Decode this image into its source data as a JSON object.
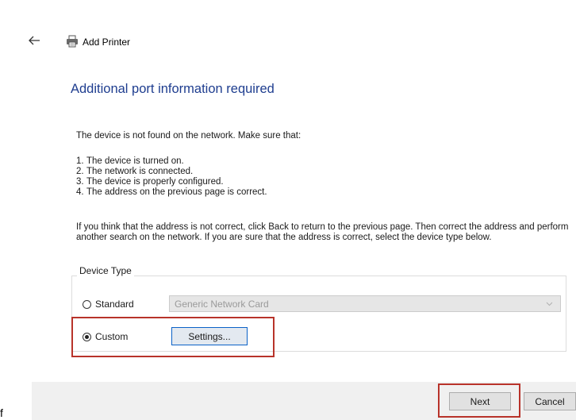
{
  "window": {
    "title": "Add Printer",
    "back_icon": "back-arrow-icon",
    "printer_icon": "printer-icon"
  },
  "heading": "Additional port information required",
  "intro": "The device is not found on the network. Make sure that:",
  "steps": [
    {
      "num": "1.",
      "text": "The device is turned on."
    },
    {
      "num": "2.",
      "text": "The network is connected."
    },
    {
      "num": "3.",
      "text": "The device is properly configured."
    },
    {
      "num": "4.",
      "text": "The address on the previous page is correct."
    }
  ],
  "paragraph": "If you think that the address is not correct, click Back to return to the previous page. Then correct the address and perform another search on the network. If you are sure that the address is correct, select the device type below.",
  "device_type": {
    "label": "Device Type",
    "standard_label": "Standard",
    "standard_selected": false,
    "standard_select_value": "Generic Network Card",
    "custom_label": "Custom",
    "custom_selected": true,
    "settings_label": "Settings..."
  },
  "footer": {
    "stray_text": "f",
    "next_label": "Next",
    "cancel_label": "Cancel"
  },
  "colors": {
    "heading": "#1e3d8f",
    "highlight": "#b8332a",
    "focus_border": "#0b62c7"
  }
}
